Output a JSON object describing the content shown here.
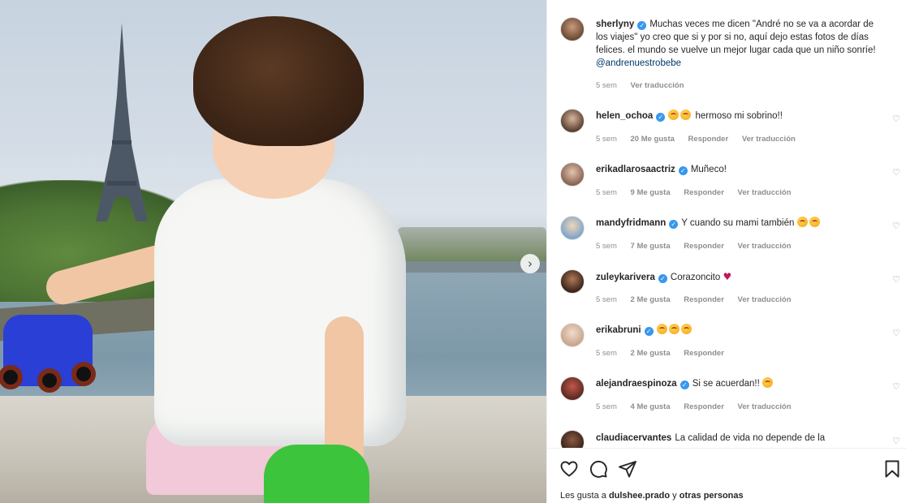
{
  "post": {
    "caption": {
      "username": "sherlyny",
      "text": "Muchas veces me dicen \"André no se va a acordar de los viajes\" yo creo que si y por si no, aquí dejo estas fotos de días felices. el mundo se vuelve un mejor lugar cada que un niño sonríe! ",
      "mention": "@andrenuestrobebe",
      "time": "5 sem",
      "translate": "Ver traducción"
    },
    "comments": [
      {
        "username": "helen_ochoa",
        "text": "hermoso mi sobrino!!",
        "emoji_count": 2,
        "heart": false,
        "time": "5 sem",
        "likes": "20 Me gusta",
        "reply": "Responder",
        "translate": "Ver traducción"
      },
      {
        "username": "erikadlarosaactriz",
        "text": "Muñeco!",
        "emoji_count": 0,
        "heart": false,
        "time": "5 sem",
        "likes": "9 Me gusta",
        "reply": "Responder",
        "translate": "Ver traducción"
      },
      {
        "username": "mandyfridmann",
        "text": "Y cuando su mami también",
        "emoji_count": 2,
        "heart": false,
        "time": "5 sem",
        "likes": "7 Me gusta",
        "reply": "Responder",
        "translate": "Ver traducción"
      },
      {
        "username": "zuleykarivera",
        "text": "Corazoncito",
        "emoji_count": 0,
        "heart": true,
        "time": "5 sem",
        "likes": "2 Me gusta",
        "reply": "Responder",
        "translate": "Ver traducción"
      },
      {
        "username": "erikabruni",
        "text": "",
        "emoji_count": 3,
        "heart": false,
        "time": "5 sem",
        "likes": "2 Me gusta",
        "reply": "Responder",
        "translate": ""
      },
      {
        "username": "alejandraespinoza",
        "text": "Si se acuerdan!!",
        "emoji_count": 1,
        "heart": false,
        "time": "5 sem",
        "likes": "4 Me gusta",
        "reply": "Responder",
        "translate": "Ver traducción"
      },
      {
        "username": "claudiacervantes",
        "text": "La calidad de vida no depende de la",
        "emoji_count": 0,
        "heart": false,
        "time": "",
        "likes": "",
        "reply": "",
        "translate": ""
      }
    ],
    "likes_line": {
      "prefix": "Les gusta a ",
      "user": "dulshee.prado",
      "middle": " y ",
      "others": "otras personas"
    },
    "icons": [
      "heart-icon",
      "comment-icon",
      "share-icon",
      "bookmark-icon"
    ],
    "accent_color": "#3897f0"
  }
}
